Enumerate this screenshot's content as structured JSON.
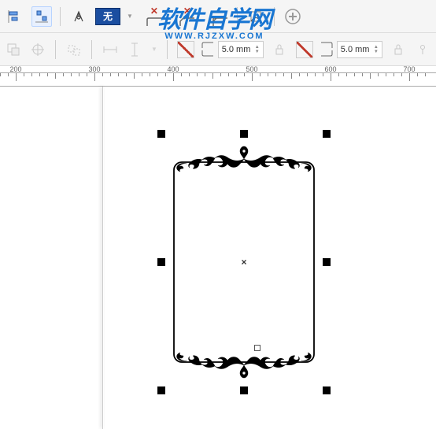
{
  "toolbar": {
    "fill_label": "无",
    "size1": "5.0 mm",
    "size2": "5.0 mm"
  },
  "ruler": {
    "ticks": [
      200,
      300,
      400,
      500,
      600,
      700
    ]
  },
  "watermark": {
    "line1": "软件自学网",
    "line2": "WWW.RJZXW.COM"
  }
}
